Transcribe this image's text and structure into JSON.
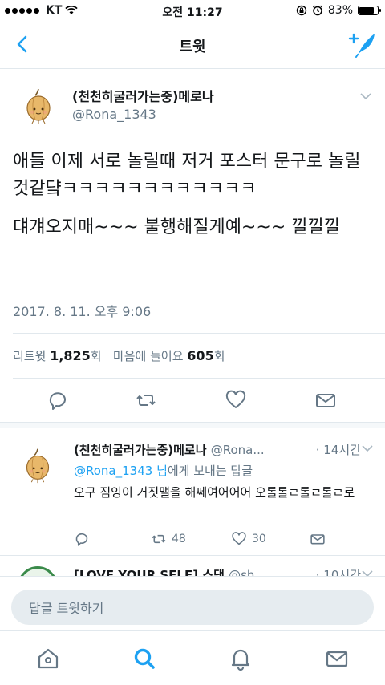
{
  "status_bar": {
    "carrier": "KT",
    "time": "오전 11:27",
    "battery": "83%",
    "battery_level": 0.83
  },
  "nav": {
    "title": "트윗",
    "back_icon": "chevron-left-icon",
    "compose_icon": "compose-tweet-icon"
  },
  "main_tweet": {
    "display_name": "(천천히굴러가는중)메로나",
    "handle": "@Rona_1343",
    "text_lines": [
      "애들  이제 서로 놀릴때  저거 포스터 문구로  놀릴것같댴ㅋㅋㅋㅋㅋㅋㅋㅋㅋㅋㅋㅋ",
      "댸걔오지매~~~  불행해질게예~~~  낄낄낄"
    ],
    "timestamp": "2017. 8. 11. 오후 9:06",
    "retweets_label": "리트윗",
    "retweets_count": "1,825",
    "retweets_unit": "회",
    "likes_label": "마음에 들어요",
    "likes_count": "605",
    "likes_unit": "회"
  },
  "replies": [
    {
      "display_name": "(천천히굴러가는중)메로나",
      "handle": "@Rona...",
      "time": "· 14시간",
      "reply_to_mention": "@Rona_1343 님",
      "reply_to_text": "에게 보내는 답글",
      "text": "오구 짐잉이  거짓맬을 해쎄여어어어  오롤롤ㄹ롤ㄹ롤ㄹ로",
      "retweet_count": "48",
      "like_count": "30"
    },
    {
      "display_name": "[LOVE YOUR SELF] 스댕",
      "handle": "@sh...",
      "time": "· 10시간"
    }
  ],
  "reply_box": {
    "placeholder": "답글 트윗하기"
  },
  "tabs": [
    "home-icon",
    "search-icon",
    "notifications-icon",
    "messages-icon"
  ],
  "colors": {
    "accent": "#1da1f2",
    "muted": "#657786",
    "text": "#14171a"
  }
}
